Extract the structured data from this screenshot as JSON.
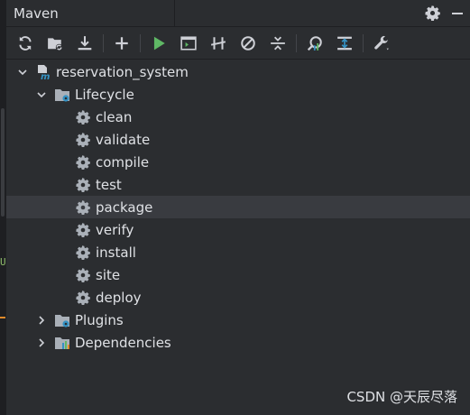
{
  "panel": {
    "title": "Maven",
    "header_icons": [
      "gear-icon",
      "minimize-icon"
    ]
  },
  "toolbar": {
    "buttons": [
      {
        "name": "reload-all-projects-icon"
      },
      {
        "name": "generate-sources-icon"
      },
      {
        "name": "download-sources-icon"
      },
      {
        "name": "add-maven-project-icon"
      },
      {
        "name": "run-maven-build-icon"
      },
      {
        "name": "execute-maven-goal-icon"
      },
      {
        "name": "toggle-offline-mode-icon"
      },
      {
        "name": "skip-tests-icon"
      },
      {
        "name": "collapse-all-icon"
      },
      {
        "name": "analyze-dependencies-icon"
      },
      {
        "name": "show-dependencies-icon"
      },
      {
        "name": "build-tool-settings-icon"
      }
    ],
    "colors": {
      "run": "#5fb865",
      "default": "#ced0d6",
      "accent": "#3592c4"
    }
  },
  "tree": {
    "root": {
      "label": "reservation_system"
    },
    "lifecycle": {
      "label": "Lifecycle"
    },
    "goals": [
      {
        "label": "clean"
      },
      {
        "label": "validate"
      },
      {
        "label": "compile"
      },
      {
        "label": "test"
      },
      {
        "label": "package"
      },
      {
        "label": "verify"
      },
      {
        "label": "install"
      },
      {
        "label": "site"
      },
      {
        "label": "deploy"
      }
    ],
    "selected_goal": "package",
    "plugins": {
      "label": "Plugins"
    },
    "dependencies": {
      "label": "Dependencies"
    }
  },
  "gutter": {
    "marker": "U"
  },
  "watermark": "CSDN @天辰尽落"
}
